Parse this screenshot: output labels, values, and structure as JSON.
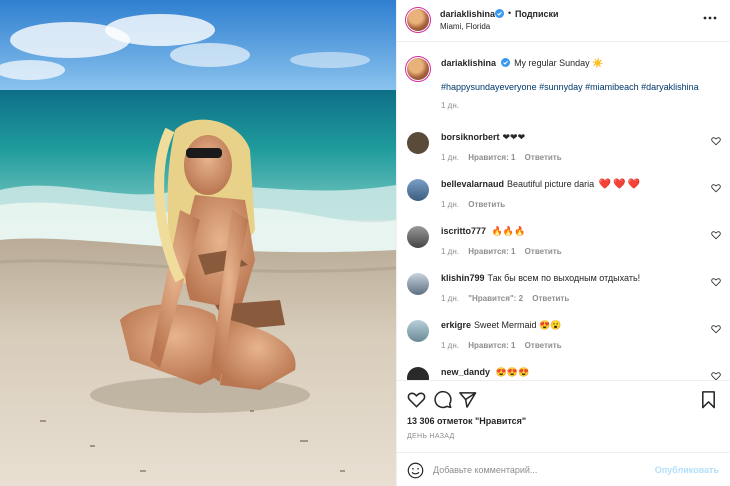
{
  "header": {
    "username": "dariaklishina",
    "separator": "•",
    "follow_label": "Подписки",
    "location": "Miami, Florida",
    "more_icon": "more-horizontal-icon"
  },
  "caption": {
    "username": "dariaklishina",
    "text": "My regular Sunday",
    "emoji": "☀️",
    "hashtags": "#happysundayeveryone #sunnyday #miamibeach #daryaklishina",
    "time": "1 дн."
  },
  "comments": [
    {
      "username": "borsiknorbert",
      "text": "❤❤❤",
      "time": "1 дн.",
      "likes": "Нравится: 1",
      "reply": "Ответить",
      "avatar_color": "#5a4a3a"
    },
    {
      "username": "bellevalarnaud",
      "text": "Beautiful picture daria",
      "time": "1 дн.",
      "likes": "",
      "reply": "Ответить",
      "avatar_color": "#4b6b8a"
    },
    {
      "username": "iscritto777",
      "text": "",
      "time": "1 дн.",
      "likes": "Нравится: 1",
      "reply": "Ответить",
      "avatar_color": "#6a6a6a"
    },
    {
      "username": "klishin799",
      "text": "Так бы всем по выходным отдыхать!",
      "time": "1 дн.",
      "likes": "\"Нравится\": 2",
      "reply": "Ответить",
      "avatar_color": "#7a8a9a"
    },
    {
      "username": "erkigre",
      "text": "Sweet Mermaid",
      "time": "1 дн.",
      "likes": "Нравится: 1",
      "reply": "Ответить",
      "avatar_color": "#8aa0a8"
    },
    {
      "username": "new_dandy",
      "text": "",
      "time": "",
      "likes": "",
      "reply": "",
      "avatar_color": "#2a2a2a"
    }
  ],
  "actions": {
    "like_icon": "heart-icon",
    "comment_icon": "comment-icon",
    "share_icon": "paper-plane-icon",
    "save_icon": "bookmark-icon"
  },
  "likes_text": "13 306 отметок \"Нравится\"",
  "date_text": "ДЕНЬ НАЗАД",
  "add_comment": {
    "placeholder": "Добавьте комментарий...",
    "publish_label": "Опубликовать",
    "emoji_icon": "smiley-icon"
  },
  "colors": {
    "link": "#00376b",
    "verified": "#3897f0",
    "publish_disabled": "#b2dffc",
    "heart_red": "#e0245e"
  }
}
